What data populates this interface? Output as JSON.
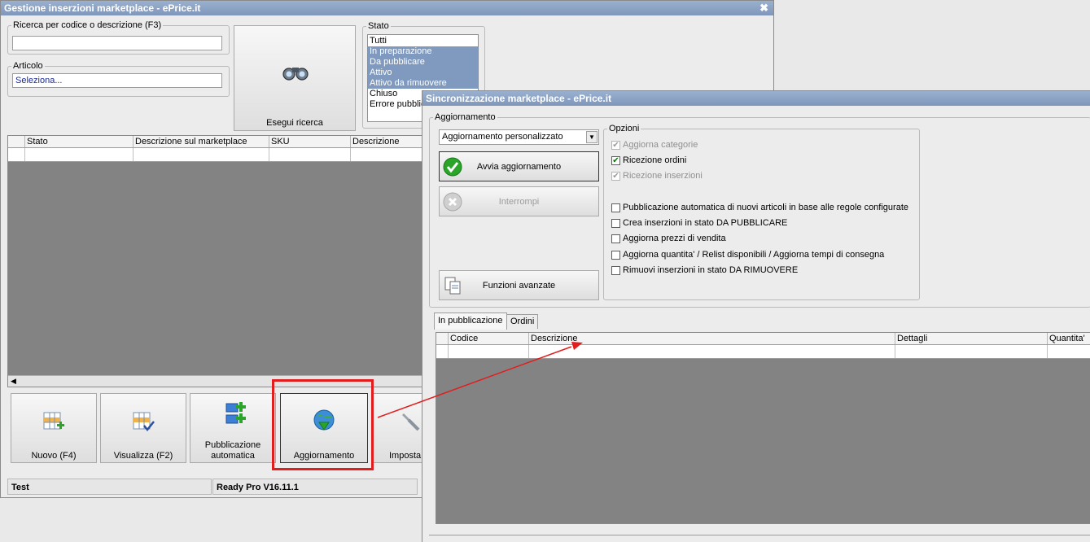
{
  "main_window": {
    "title": "Gestione inserzioni marketplace - ePrice.it",
    "close_glyph": "✖",
    "search": {
      "label": "Ricerca per codice o descrizione (F3)",
      "value": ""
    },
    "article": {
      "label": "Articolo",
      "value": "Seleziona..."
    },
    "search_button": "Esegui ricerca",
    "stato": {
      "label": "Stato",
      "items": [
        {
          "label": "Tutti",
          "selected": false
        },
        {
          "label": "In preparazione",
          "selected": true
        },
        {
          "label": "Da pubblicare",
          "selected": true
        },
        {
          "label": "Attivo",
          "selected": true
        },
        {
          "label": "Attivo da rimuovere",
          "selected": true
        },
        {
          "label": "Chiuso",
          "selected": false
        },
        {
          "label": "Errore pubblicazione",
          "selected": false
        }
      ]
    },
    "grid_columns": [
      "Stato",
      "Descrizione sul marketplace",
      "SKU",
      "Descrizione"
    ],
    "toolbar": [
      {
        "label": "Nuovo (F4)",
        "icon": "grid-add-icon"
      },
      {
        "label": "Visualizza (F2)",
        "icon": "grid-check-icon"
      },
      {
        "label": "Pubblicazione automatica",
        "icon": "automatic-publish-icon"
      },
      {
        "label": "Aggiornamento",
        "icon": "globe-download-icon"
      },
      {
        "label": "Imposta",
        "icon": "wrench-icon"
      }
    ],
    "status_bar": {
      "left": "Test",
      "right": "Ready Pro V16.11.1"
    }
  },
  "sync_window": {
    "title": "Sincronizzazione marketplace - ePrice.it",
    "group_label": "Aggiornamento",
    "mode_select": "Aggiornamento personalizzato",
    "start_button": "Avvia aggiornamento",
    "stop_button": "Interrompi",
    "advanced_button": "Funzioni avanzate",
    "options_label": "Opzioni",
    "options": [
      {
        "label": "Aggiorna categorie",
        "checked": true,
        "disabled": true
      },
      {
        "label": "Ricezione ordini",
        "checked": true,
        "disabled": false
      },
      {
        "label": "Ricezione inserzioni",
        "checked": true,
        "disabled": true
      },
      {
        "label": "Pubblicazione automatica di nuovi articoli in base alle regole configurate",
        "checked": false,
        "disabled": false
      },
      {
        "label": "Crea inserzioni in stato DA PUBBLICARE",
        "checked": false,
        "disabled": false
      },
      {
        "label": "Aggiorna prezzi di vendita",
        "checked": false,
        "disabled": false
      },
      {
        "label": "Aggiorna quantita' / Relist disponibili / Aggiorna tempi di consegna",
        "checked": false,
        "disabled": false
      },
      {
        "label": "Rimuovi inserzioni in stato DA RIMUOVERE",
        "checked": false,
        "disabled": false
      }
    ],
    "tabs": [
      "In pubblicazione",
      "Ordini"
    ],
    "grid_columns": [
      "Codice",
      "Descrizione",
      "Dettagli",
      "Quantita'"
    ]
  },
  "annotation": {
    "highlight_color": "#e11d1d"
  }
}
